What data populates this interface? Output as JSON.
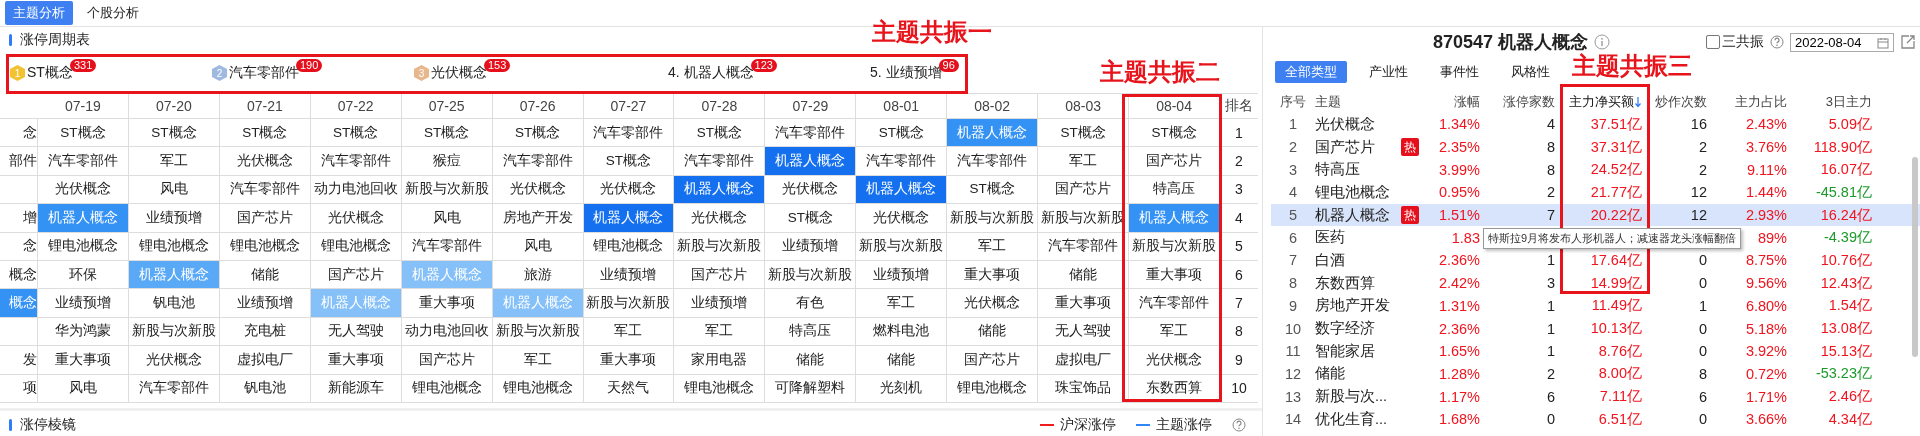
{
  "top_tabs": [
    {
      "label": "主题分析",
      "selected": true
    },
    {
      "label": "个股分析",
      "selected": false
    }
  ],
  "cycle_table": {
    "title": "涨停周期表",
    "top_themes": [
      {
        "kind": "medal",
        "rank": "1",
        "name": "ST概念",
        "count": "331",
        "color": "#f2c230"
      },
      {
        "kind": "medal",
        "rank": "2",
        "name": "汽车零部件",
        "count": "190",
        "color": "#9fb9e0"
      },
      {
        "kind": "medal",
        "rank": "3",
        "name": "光伏概念",
        "count": "153",
        "color": "#e7b88e"
      },
      {
        "kind": "plain",
        "name": "4. 机器人概念",
        "count": "123"
      },
      {
        "kind": "plain",
        "name": "5. 业绩预增",
        "count": "96"
      }
    ],
    "columns": [
      "07-19",
      "07-20",
      "07-21",
      "07-22",
      "07-25",
      "07-26",
      "07-27",
      "07-28",
      "07-29",
      "08-01",
      "08-02",
      "08-03",
      "08-04"
    ],
    "rank_header": "排名",
    "rows": [
      {
        "cut": {
          "text": "念"
        },
        "rank": "1",
        "cells": [
          {
            "text": "ST概念"
          },
          {
            "text": "ST概念"
          },
          {
            "text": "ST概念"
          },
          {
            "text": "ST概念"
          },
          {
            "text": "ST概念"
          },
          {
            "text": "ST概念"
          },
          {
            "text": "汽车零部件"
          },
          {
            "text": "ST概念"
          },
          {
            "text": "汽车零部件"
          },
          {
            "text": "ST概念"
          },
          {
            "text": "机器人概念",
            "color": "#3592f5"
          },
          {
            "text": "ST概念"
          },
          {
            "text": "ST概念"
          }
        ]
      },
      {
        "cut": {
          "text": "部件"
        },
        "rank": "2",
        "cells": [
          {
            "text": "汽车零部件"
          },
          {
            "text": "军工"
          },
          {
            "text": "光伏概念"
          },
          {
            "text": "汽车零部件"
          },
          {
            "text": "猴痘"
          },
          {
            "text": "汽车零部件"
          },
          {
            "text": "ST概念"
          },
          {
            "text": "汽车零部件"
          },
          {
            "text": "机器人概念",
            "color": "#1470ee"
          },
          {
            "text": "汽车零部件"
          },
          {
            "text": "汽车零部件"
          },
          {
            "text": "军工"
          },
          {
            "text": "国产芯片"
          }
        ]
      },
      {
        "cut": {},
        "rank": "3",
        "cells": [
          {
            "text": "光伏概念"
          },
          {
            "text": "风电"
          },
          {
            "text": "汽车零部件"
          },
          {
            "text": "动力电池回收"
          },
          {
            "text": "新股与次新股"
          },
          {
            "text": "光伏概念"
          },
          {
            "text": "光伏概念"
          },
          {
            "text": "机器人概念",
            "color": "#1470ee"
          },
          {
            "text": "光伏概念"
          },
          {
            "text": "机器人概念",
            "color": "#1470ee"
          },
          {
            "text": "ST概念"
          },
          {
            "text": "国产芯片"
          },
          {
            "text": "特高压"
          }
        ]
      },
      {
        "cut": {
          "text": "增"
        },
        "rank": "4",
        "cells": [
          {
            "text": "机器人概念",
            "color": "#3592f5"
          },
          {
            "text": "业绩预增"
          },
          {
            "text": "国产芯片"
          },
          {
            "text": "光伏概念"
          },
          {
            "text": "风电"
          },
          {
            "text": "房地产开发"
          },
          {
            "text": "机器人概念",
            "color": "#1470ee"
          },
          {
            "text": "光伏概念"
          },
          {
            "text": "ST概念"
          },
          {
            "text": "光伏概念"
          },
          {
            "text": "新股与次新股"
          },
          {
            "text": "新股与次新股"
          },
          {
            "text": "机器人概念",
            "color": "#3592f5"
          }
        ]
      },
      {
        "cut": {
          "text": "念"
        },
        "rank": "5",
        "cells": [
          {
            "text": "锂电池概念"
          },
          {
            "text": "锂电池概念"
          },
          {
            "text": "锂电池概念"
          },
          {
            "text": "锂电池概念"
          },
          {
            "text": "汽车零部件"
          },
          {
            "text": "风电"
          },
          {
            "text": "锂电池概念"
          },
          {
            "text": "新股与次新股"
          },
          {
            "text": "业绩预增"
          },
          {
            "text": "新股与次新股"
          },
          {
            "text": "军工"
          },
          {
            "text": "汽车零部件"
          },
          {
            "text": "新股与次新股"
          }
        ]
      },
      {
        "cut": {
          "text": "概念"
        },
        "rank": "6",
        "cells": [
          {
            "text": "环保"
          },
          {
            "text": "机器人概念",
            "color": "#5aa9f7"
          },
          {
            "text": "储能"
          },
          {
            "text": "国产芯片"
          },
          {
            "text": "机器人概念",
            "color": "#85c0f8"
          },
          {
            "text": "旅游"
          },
          {
            "text": "业绩预增"
          },
          {
            "text": "国产芯片"
          },
          {
            "text": "新股与次新股"
          },
          {
            "text": "业绩预增"
          },
          {
            "text": "重大事项"
          },
          {
            "text": "储能"
          },
          {
            "text": "重大事项"
          }
        ]
      },
      {
        "cut": {
          "text": "概念",
          "color": "#3592f5"
        },
        "rank": "7",
        "cells": [
          {
            "text": "业绩预增"
          },
          {
            "text": "钒电池"
          },
          {
            "text": "业绩预增"
          },
          {
            "text": "机器人概念",
            "color": "#85c0f8"
          },
          {
            "text": "重大事项"
          },
          {
            "text": "机器人概念",
            "color": "#85c0f8"
          },
          {
            "text": "新股与次新股"
          },
          {
            "text": "业绩预增"
          },
          {
            "text": "有色"
          },
          {
            "text": "军工"
          },
          {
            "text": "光伏概念"
          },
          {
            "text": "重大事项"
          },
          {
            "text": "汽车零部件"
          }
        ]
      },
      {
        "cut": {},
        "rank": "8",
        "cells": [
          {
            "text": "华为鸿蒙"
          },
          {
            "text": "新股与次新股"
          },
          {
            "text": "充电桩"
          },
          {
            "text": "无人驾驶"
          },
          {
            "text": "动力电池回收"
          },
          {
            "text": "新股与次新股"
          },
          {
            "text": "军工"
          },
          {
            "text": "军工"
          },
          {
            "text": "特高压"
          },
          {
            "text": "燃料电池"
          },
          {
            "text": "储能"
          },
          {
            "text": "无人驾驶"
          },
          {
            "text": "军工"
          }
        ]
      },
      {
        "cut": {
          "text": "发"
        },
        "rank": "9",
        "cells": [
          {
            "text": "重大事项"
          },
          {
            "text": "光伏概念"
          },
          {
            "text": "虚拟电厂"
          },
          {
            "text": "重大事项"
          },
          {
            "text": "国产芯片"
          },
          {
            "text": "军工"
          },
          {
            "text": "重大事项"
          },
          {
            "text": "家用电器"
          },
          {
            "text": "储能"
          },
          {
            "text": "储能"
          },
          {
            "text": "国产芯片"
          },
          {
            "text": "虚拟电厂"
          },
          {
            "text": "光伏概念"
          }
        ]
      },
      {
        "cut": {
          "text": "项"
        },
        "rank": "10",
        "cells": [
          {
            "text": "风电"
          },
          {
            "text": "汽车零部件"
          },
          {
            "text": "钒电池"
          },
          {
            "text": "新能源车"
          },
          {
            "text": "锂电池概念"
          },
          {
            "text": "锂电池概念"
          },
          {
            "text": "天然气"
          },
          {
            "text": "锂电池概念"
          },
          {
            "text": "可降解塑料"
          },
          {
            "text": "光刻机"
          },
          {
            "text": "锂电池概念"
          },
          {
            "text": "珠宝饰品"
          },
          {
            "text": "东数西算"
          }
        ]
      }
    ]
  },
  "prism": {
    "title": "涨停棱镜",
    "legend": [
      {
        "label": "沪深涨停",
        "color": "#f01c1c"
      },
      {
        "label": "主题涨停",
        "color": "#2f86f6"
      }
    ]
  },
  "detail": {
    "title": "870547 机器人概念",
    "resonance": {
      "label": "三共振",
      "checked": false
    },
    "date": "2022-08-04",
    "tabs": [
      {
        "label": "全部类型",
        "selected": true
      },
      {
        "label": "产业性",
        "selected": false
      },
      {
        "label": "事件性",
        "selected": false
      },
      {
        "label": "风格性",
        "selected": false
      }
    ],
    "columns": [
      "序号",
      "主题",
      "涨幅",
      "涨停家数",
      "主力净买额",
      "炒作次数",
      "主力占比",
      "3日主力"
    ],
    "rows": [
      {
        "no": "1",
        "theme": "光伏概念",
        "change": "1.34%",
        "limit_ups": "4",
        "net_buy": "37.51亿",
        "times": "16",
        "ratio": "2.43%",
        "three_day": "5.09亿",
        "three_day_down": false,
        "selected": false
      },
      {
        "no": "2",
        "theme": "国产芯片",
        "badge": "热",
        "change": "2.35%",
        "limit_ups": "8",
        "net_buy": "37.31亿",
        "times": "2",
        "ratio": "3.76%",
        "three_day": "118.90亿",
        "three_day_down": false,
        "selected": false
      },
      {
        "no": "3",
        "theme": "特高压",
        "change": "3.99%",
        "limit_ups": "8",
        "net_buy": "24.52亿",
        "times": "2",
        "ratio": "9.11%",
        "three_day": "16.07亿",
        "three_day_down": false,
        "selected": false
      },
      {
        "no": "4",
        "theme": "锂电池概念",
        "change": "0.95%",
        "limit_ups": "2",
        "net_buy": "21.77亿",
        "times": "12",
        "ratio": "1.44%",
        "three_day": "-45.81亿",
        "three_day_down": true,
        "selected": false
      },
      {
        "no": "5",
        "theme": "机器人概念",
        "badge": "热",
        "change": "1.51%",
        "limit_ups": "7",
        "net_buy": "20.22亿",
        "times": "12",
        "ratio": "2.93%",
        "three_day": "16.24亿",
        "three_day_down": false,
        "selected": true
      },
      {
        "no": "6",
        "theme": "医药",
        "change": "1.83",
        "ratio": "89%",
        "three_day": "-4.39亿",
        "three_day_down": true,
        "selected": false,
        "tooltip": "特斯拉9月将发布人形机器人；减速器龙头涨幅翻倍"
      },
      {
        "no": "7",
        "theme": "白酒",
        "change": "2.36%",
        "limit_ups": "1",
        "net_buy": "17.64亿",
        "times": "0",
        "ratio": "8.75%",
        "three_day": "10.76亿",
        "three_day_down": false,
        "selected": false
      },
      {
        "no": "8",
        "theme": "东数西算",
        "change": "2.42%",
        "limit_ups": "3",
        "net_buy": "14.99亿",
        "times": "0",
        "ratio": "9.56%",
        "three_day": "12.43亿",
        "three_day_down": false,
        "selected": false
      },
      {
        "no": "9",
        "theme": "房地产开发",
        "change": "1.31%",
        "limit_ups": "1",
        "net_buy": "11.49亿",
        "times": "1",
        "ratio": "6.80%",
        "three_day": "1.54亿",
        "three_day_down": false,
        "selected": false
      },
      {
        "no": "10",
        "theme": "数字经济",
        "change": "2.36%",
        "limit_ups": "1",
        "net_buy": "10.13亿",
        "times": "0",
        "ratio": "5.18%",
        "three_day": "13.08亿",
        "three_day_down": false,
        "selected": false
      },
      {
        "no": "11",
        "theme": "智能家居",
        "change": "1.65%",
        "limit_ups": "1",
        "net_buy": "8.76亿",
        "times": "0",
        "ratio": "3.92%",
        "three_day": "15.13亿",
        "three_day_down": false,
        "selected": false
      },
      {
        "no": "12",
        "theme": "储能",
        "change": "1.28%",
        "limit_ups": "2",
        "net_buy": "8.00亿",
        "times": "8",
        "ratio": "0.72%",
        "three_day": "-53.23亿",
        "three_day_down": true,
        "selected": false
      },
      {
        "no": "13",
        "theme": "新股与次...",
        "change": "1.17%",
        "limit_ups": "6",
        "net_buy": "7.11亿",
        "times": "6",
        "ratio": "1.71%",
        "three_day": "2.46亿",
        "three_day_down": false,
        "selected": false
      },
      {
        "no": "14",
        "theme": "优化生育...",
        "change": "1.68%",
        "limit_ups": "0",
        "net_buy": "6.51亿",
        "times": "0",
        "ratio": "3.66%",
        "three_day": "4.34亿",
        "three_day_down": false,
        "selected": false
      }
    ]
  },
  "annotations": [
    {
      "label": "主题共振一"
    },
    {
      "label": "主题共振二"
    },
    {
      "label": "主题共振三"
    }
  ]
}
